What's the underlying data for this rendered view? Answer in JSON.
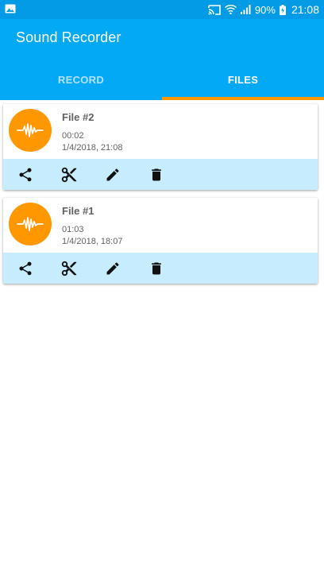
{
  "status_bar": {
    "battery": "90%",
    "time": "21:08"
  },
  "app": {
    "title": "Sound Recorder"
  },
  "tabs": [
    {
      "label": "RECORD",
      "active": false
    },
    {
      "label": "FILES",
      "active": true
    }
  ],
  "colors": {
    "primary": "#03a9f4",
    "status_bar": "#039be5",
    "accent": "#ff9800",
    "action_bar": "#c6ecfd"
  },
  "files": [
    {
      "name": "File #2",
      "duration": "00:02",
      "date": "1/4/2018, 21:08"
    },
    {
      "name": "File #1",
      "duration": "01:03",
      "date": "1/4/2018, 18:07"
    }
  ],
  "actions": [
    "share-icon",
    "cut-icon",
    "edit-icon",
    "delete-icon"
  ]
}
